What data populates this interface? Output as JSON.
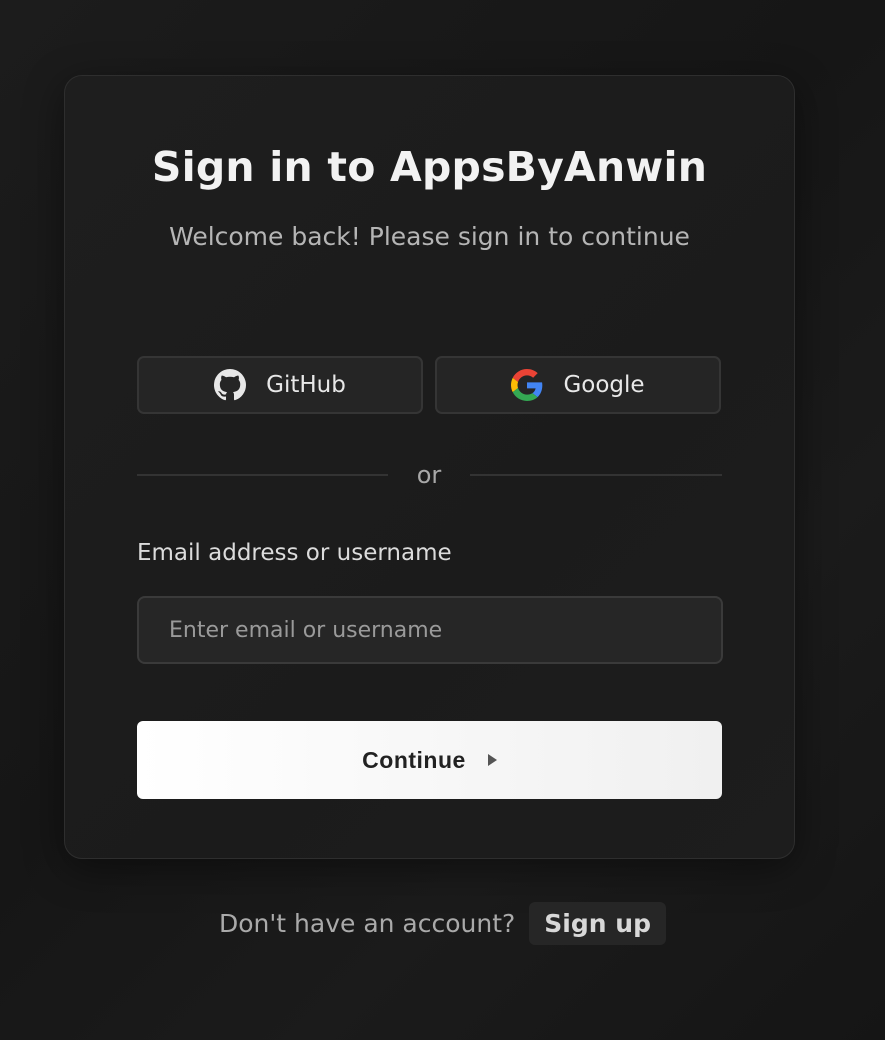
{
  "auth": {
    "title": "Sign in to AppsByAnwin",
    "subtitle": "Welcome back! Please sign in to continue",
    "providers": [
      {
        "label": "GitHub",
        "icon": "github-icon"
      },
      {
        "label": "Google",
        "icon": "google-icon"
      }
    ],
    "divider_text": "or",
    "email_label": "Email address or username",
    "email_placeholder": "Enter email or username",
    "email_value": "",
    "continue_label": "Continue"
  },
  "footer": {
    "prompt": "Don't have an account?",
    "signup_label": "Sign up"
  },
  "colors": {
    "background": "#1a1a1a",
    "card": "#1e1e1e",
    "button_primary": "#ffffff"
  }
}
